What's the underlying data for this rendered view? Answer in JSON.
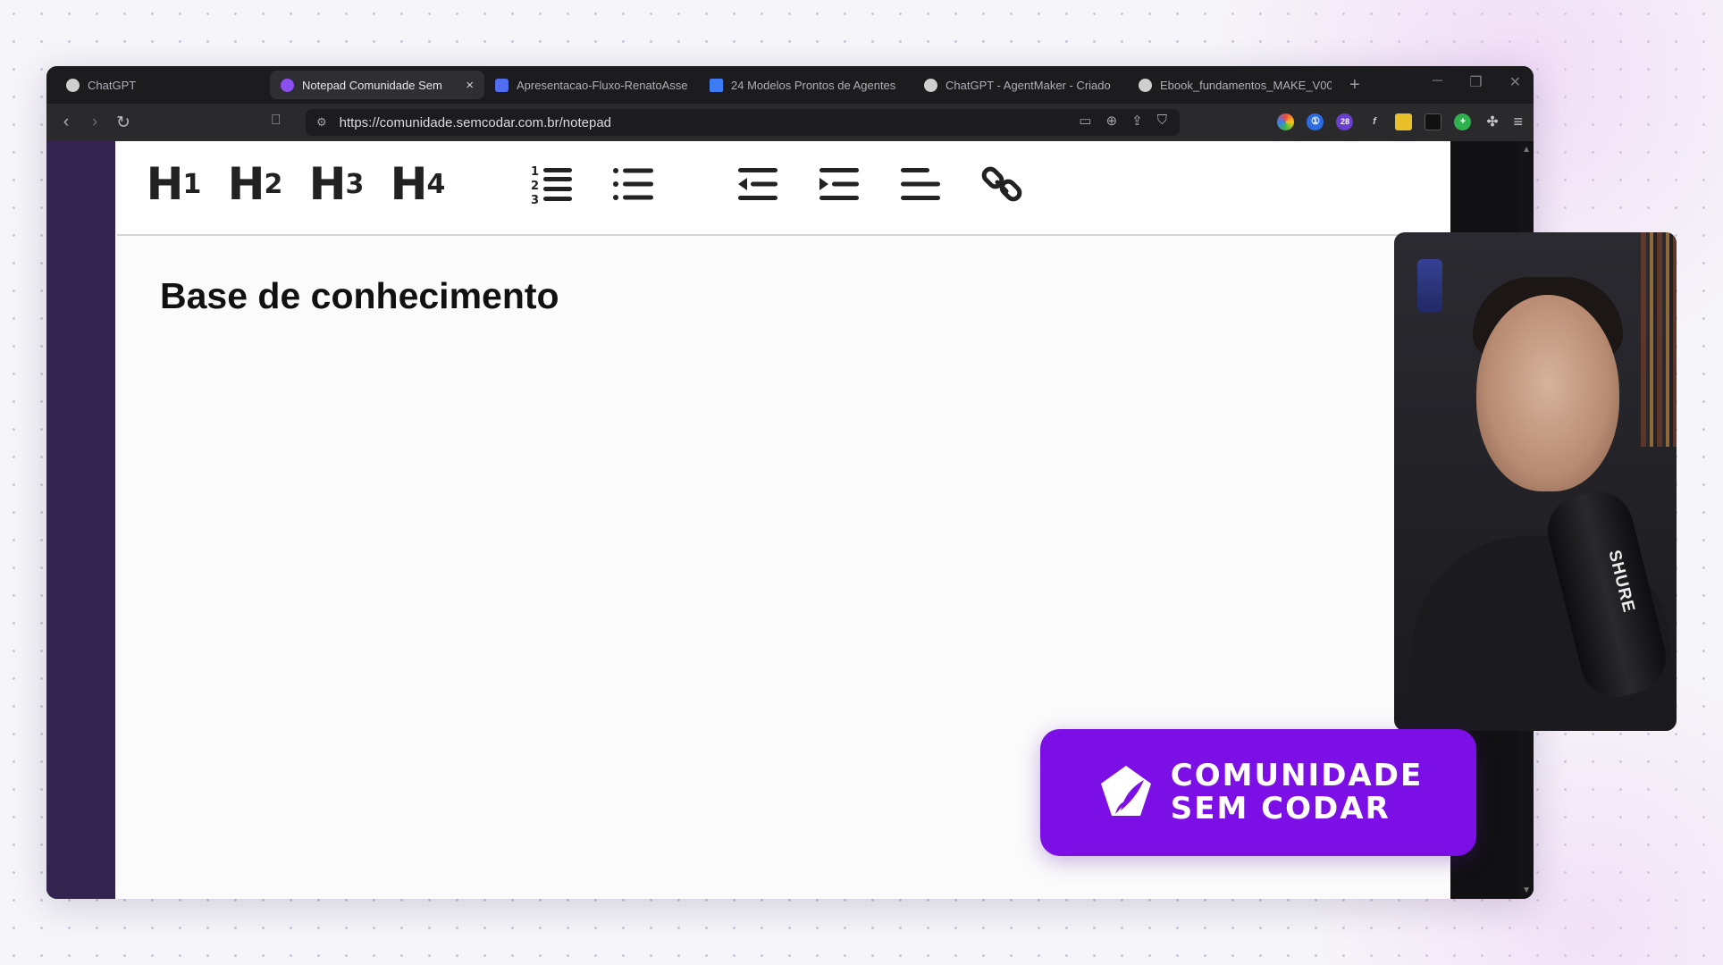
{
  "browser": {
    "tabs": [
      {
        "title": "ChatGPT",
        "favicon_color": "#cfcfcf",
        "active": false
      },
      {
        "title": "Notepad Comunidade Sem",
        "favicon_color": "#8c4ff0",
        "active": true
      },
      {
        "title": "Apresentacao-Fluxo-RenatoAsse",
        "favicon_color": "#4f6df0",
        "active": false
      },
      {
        "title": "24 Modelos Prontos de Agentes",
        "favicon_color": "#3b7cf5",
        "active": false
      },
      {
        "title": "ChatGPT - AgentMaker - Criado",
        "favicon_color": "#cfcfcf",
        "active": false
      },
      {
        "title": "Ebook_fundamentos_MAKE_V00",
        "favicon_color": "#cfcfcf",
        "active": false
      }
    ],
    "close_glyph": "×",
    "new_tab_glyph": "+",
    "url": "https://comunidade.semcodar.com.br/notepad",
    "extension_badge": "28"
  },
  "editor": {
    "headings": [
      {
        "label": "H",
        "level": "1"
      },
      {
        "label": "H",
        "level": "2"
      },
      {
        "label": "H",
        "level": "3"
      },
      {
        "label": "H",
        "level": "4"
      }
    ],
    "document_title": "Base de conhecimento"
  },
  "webcam": {
    "mic_brand": "SHURE"
  },
  "brand": {
    "line1": "COMUNIDADE",
    "line2": "SEM CODAR",
    "color": "#7b0fe6"
  }
}
